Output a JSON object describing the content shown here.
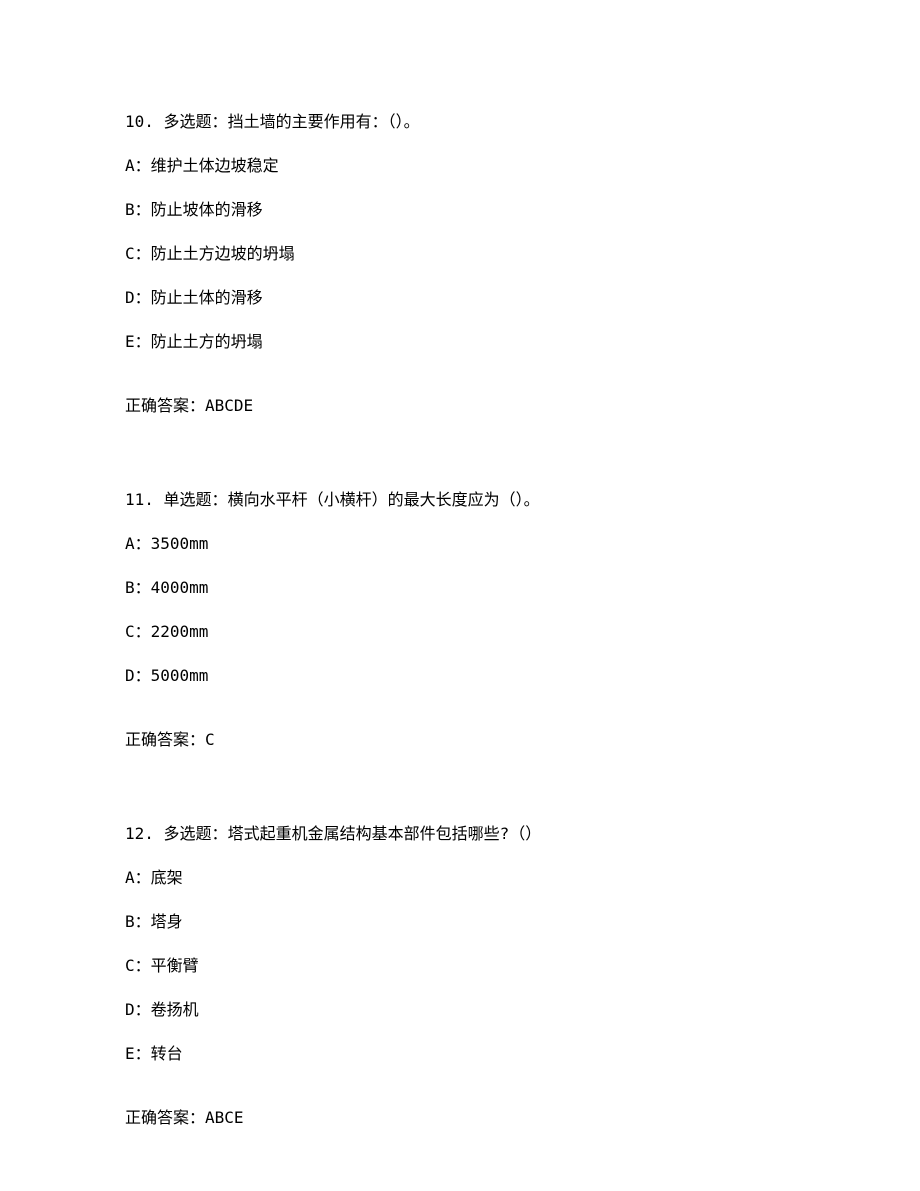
{
  "questions": [
    {
      "number": "10.",
      "type": "多选题：",
      "stem": "挡土墙的主要作用有：（）。",
      "options": [
        {
          "letter": "A：",
          "text": "维护土体边坡稳定"
        },
        {
          "letter": "B：",
          "text": "防止坡体的滑移"
        },
        {
          "letter": "C：",
          "text": "防止土方边坡的坍塌"
        },
        {
          "letter": "D：",
          "text": "防止土体的滑移"
        },
        {
          "letter": "E：",
          "text": "防止土方的坍塌"
        }
      ],
      "answer_label": "正确答案：",
      "answer": "ABCDE"
    },
    {
      "number": "11.",
      "type": "单选题：",
      "stem": "横向水平杆（小横杆）的最大长度应为（）。",
      "options": [
        {
          "letter": "A：",
          "text": "3500mm"
        },
        {
          "letter": "B：",
          "text": "4000mm"
        },
        {
          "letter": "C：",
          "text": "2200mm"
        },
        {
          "letter": "D：",
          "text": "5000mm"
        }
      ],
      "answer_label": "正确答案：",
      "answer": "C"
    },
    {
      "number": "12.",
      "type": "多选题：",
      "stem": "塔式起重机金属结构基本部件包括哪些?（）",
      "options": [
        {
          "letter": "A：",
          "text": "底架"
        },
        {
          "letter": "B：",
          "text": "塔身"
        },
        {
          "letter": "C：",
          "text": "平衡臂"
        },
        {
          "letter": "D：",
          "text": "卷扬机"
        },
        {
          "letter": "E：",
          "text": "转台"
        }
      ],
      "answer_label": "正确答案：",
      "answer": "ABCE"
    }
  ]
}
